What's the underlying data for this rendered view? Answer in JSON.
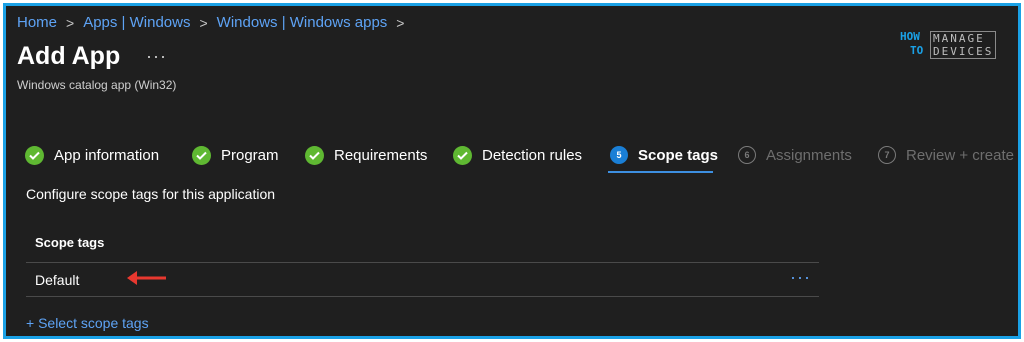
{
  "breadcrumb": [
    "Home",
    "Apps | Windows",
    "Windows | Windows apps"
  ],
  "breadcrumb_separator": ">",
  "title": "Add App",
  "title_more": "···",
  "subtitle": "Windows catalog app (Win32)",
  "logo": {
    "how": "HOW",
    "to": "TO",
    "line1": "MANAGE",
    "line2": "DEVICES"
  },
  "steps": [
    {
      "label": "App information",
      "state": "complete"
    },
    {
      "label": "Program",
      "state": "complete"
    },
    {
      "label": "Requirements",
      "state": "complete"
    },
    {
      "label": "Detection rules",
      "state": "complete"
    },
    {
      "number": "5",
      "label": "Scope tags",
      "state": "active"
    },
    {
      "number": "6",
      "label": "Assignments",
      "state": "disabled"
    },
    {
      "number": "7",
      "label": "Review + create",
      "state": "disabled"
    }
  ],
  "description": "Configure scope tags for this application",
  "table": {
    "header": "Scope tags",
    "rows": [
      {
        "name": "Default",
        "menu": "···"
      }
    ]
  },
  "select_link": "+ Select scope tags",
  "colors": {
    "background": "#1f1f1f",
    "border": "#1aa1e6",
    "link": "#5ea3f5",
    "check": "#5fb832",
    "active_step": "#1a7fd6",
    "annotation_arrow": "#e8382f"
  }
}
